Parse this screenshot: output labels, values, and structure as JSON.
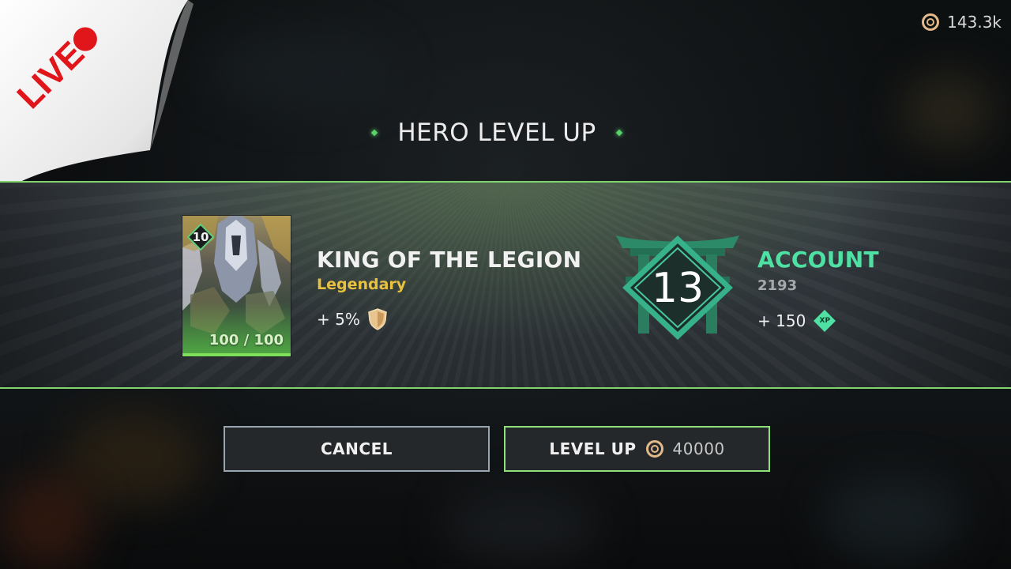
{
  "top_bar": {
    "currency_amount": "143.3k",
    "currency_icon": "coin-icon"
  },
  "live_sticker": {
    "label": "LIVE",
    "color": "#e0161b"
  },
  "title": "HERO LEVEL UP",
  "hero": {
    "name": "KING OF THE LEGION",
    "rarity": "Legendary",
    "level": "10",
    "xp_text": "100 / 100",
    "xp_progress": 1.0,
    "bonus": "+ 5%",
    "bonus_icon": "shield-icon"
  },
  "account": {
    "title": "ACCOUNT",
    "level": "13",
    "points": "2193",
    "xp_gain": "+ 150",
    "xp_badge": "XP"
  },
  "buttons": {
    "cancel": "CANCEL",
    "level_up": "LEVEL UP",
    "level_up_cost": "40000"
  },
  "colors": {
    "accent_green": "#7fd46e",
    "account_teal": "#4fe0a4",
    "rarity_gold": "#e8c13e"
  }
}
